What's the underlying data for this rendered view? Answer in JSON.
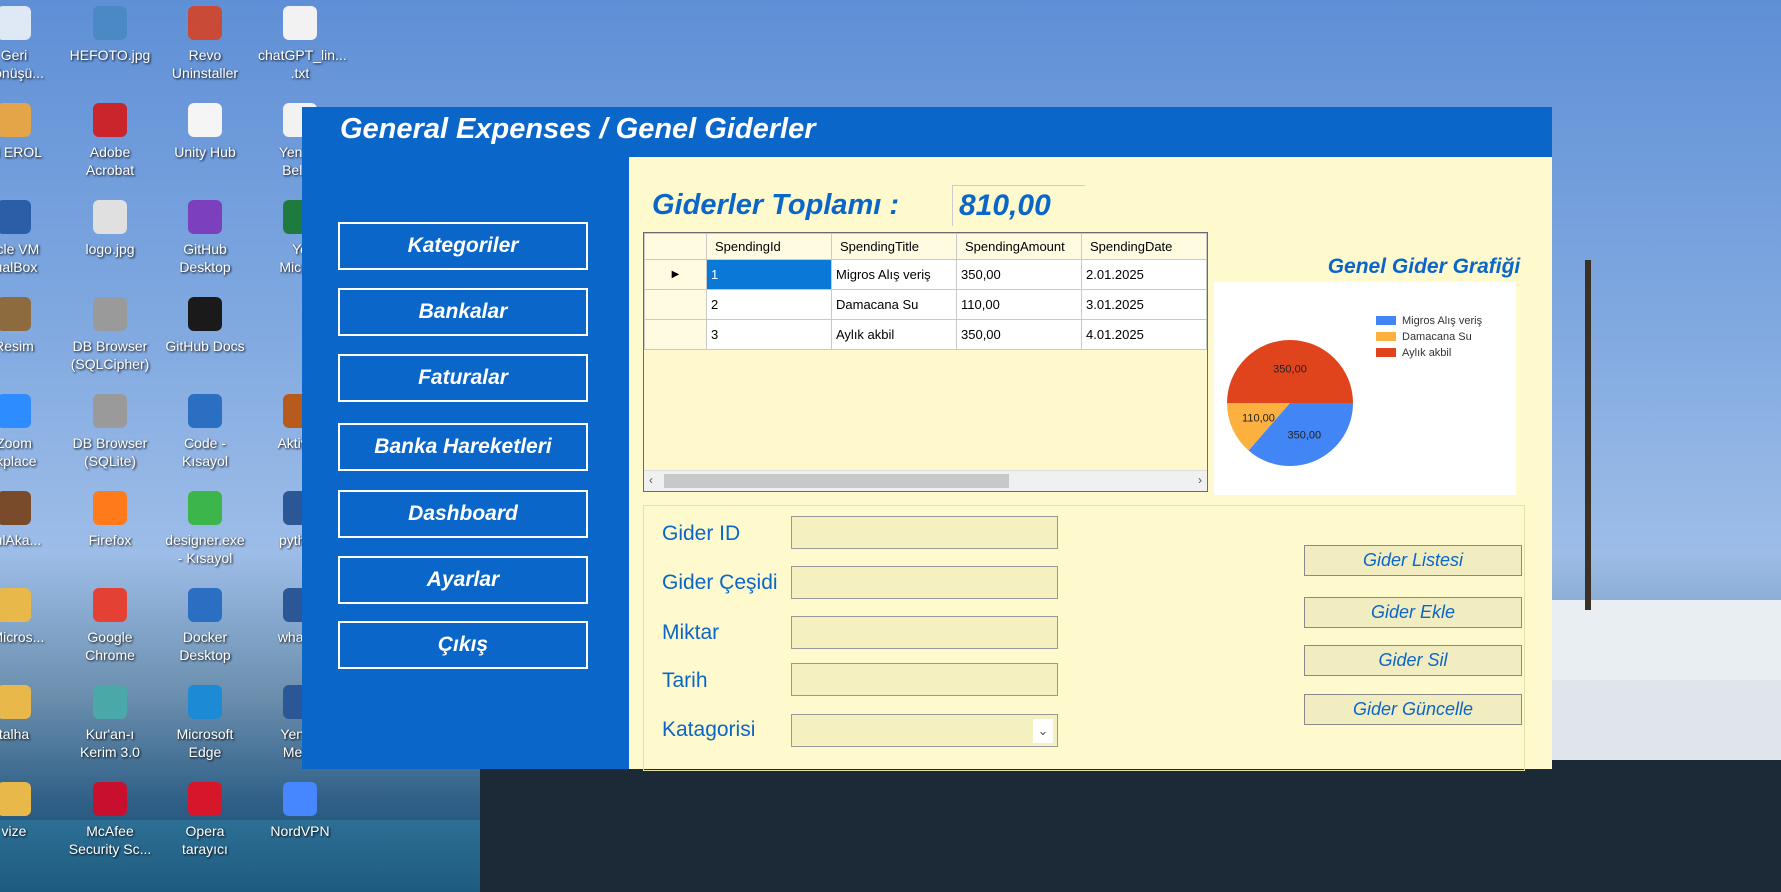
{
  "desktop": {
    "icons": [
      {
        "label": "Geri\nDönüşü...",
        "color": "#dfe9f6"
      },
      {
        "label": "HEFOTO.jpg",
        "color": "#4a89c4"
      },
      {
        "label": "Revo\nUninstaller",
        "color": "#c94b37"
      },
      {
        "label": "chatGPT_lin...\n.txt",
        "color": "#f2f2f2"
      },
      {
        "label": "IN EROL",
        "color": "#e4a548"
      },
      {
        "label": "Adobe\nAcrobat",
        "color": "#c9252b"
      },
      {
        "label": "Unity Hub",
        "color": "#f5f5f5"
      },
      {
        "label": "Yeni M\nBelge",
        "color": "#f2f2f2"
      },
      {
        "label": "acle VM\ntualBox",
        "color": "#2a5fa8"
      },
      {
        "label": "logo.jpg",
        "color": "#e0e0e0"
      },
      {
        "label": "GitHub\nDesktop",
        "color": "#7c3fbe"
      },
      {
        "label": "Ye\nMicros",
        "color": "#1f7a3e"
      },
      {
        "label": "Resim",
        "color": "#8e6b3f"
      },
      {
        "label": "DB Browser\n(SQLCipher)",
        "color": "#9a9a9a"
      },
      {
        "label": "GitHub Docs",
        "color": "#1a1a1a"
      },
      {
        "label": "Zoom\nrkplace",
        "color": "#2d8cff"
      },
      {
        "label": "DB Browser\n(SQLite)",
        "color": "#9a9a9a"
      },
      {
        "label": "Code -\nKısayol",
        "color": "#2a6fc2"
      },
      {
        "label": "Aktivas",
        "color": "#b85a1c"
      },
      {
        "label": "bulAka...",
        "color": "#7a4b2a"
      },
      {
        "label": "Firefox",
        "color": "#ff7a1a"
      },
      {
        "label": "designer.exe\n- Kısayol",
        "color": "#3cb54a"
      },
      {
        "label": "python",
        "color": "#2b5797"
      },
      {
        "label": "nMicros...",
        "color": "#e8b94a"
      },
      {
        "label": "Google\nChrome",
        "color": "#e44134"
      },
      {
        "label": "Docker\nDesktop",
        "color": "#2a6fc2"
      },
      {
        "label": "whatsa",
        "color": "#2b5797"
      },
      {
        "label": "talha",
        "color": "#e8b94a"
      },
      {
        "label": "Kur'an-ı\nKerim 3.0",
        "color": "#4aa8a8"
      },
      {
        "label": "Microsoft\nEdge",
        "color": "#1d8ad6"
      },
      {
        "label": "Yeni Z\nMetin",
        "color": "#2b5797"
      },
      {
        "label": "vize",
        "color": "#e8b94a"
      },
      {
        "label": "McAfee\nSecurity Sc...",
        "color": "#c8102e"
      },
      {
        "label": "Opera\ntarayıcı",
        "color": "#d6172a"
      },
      {
        "label": "NordVPN",
        "color": "#4687ff"
      }
    ]
  },
  "window": {
    "title": "General Expenses / Genel Giderler"
  },
  "sidebar": {
    "items": [
      {
        "label": "Kategoriler"
      },
      {
        "label": "Bankalar"
      },
      {
        "label": "Faturalar"
      },
      {
        "label": "Banka Hareketleri"
      },
      {
        "label": "Dashboard"
      },
      {
        "label": "Ayarlar"
      },
      {
        "label": "Çıkış"
      }
    ]
  },
  "summary": {
    "label": "Giderler Toplamı :",
    "value": "810,00"
  },
  "grid": {
    "columns": [
      "SpendingId",
      "SpendingTitle",
      "SpendingAmount",
      "SpendingDate"
    ],
    "rows": [
      [
        "1",
        "Migros Alış veriş",
        "350,00",
        "2.01.2025"
      ],
      [
        "2",
        "Damacana Su",
        "110,00",
        "3.01.2025"
      ],
      [
        "3",
        "Aylık akbil",
        "350,00",
        "4.01.2025"
      ]
    ],
    "selected_row": 0,
    "row_indicator": "▶",
    "scroll_left": "‹",
    "scroll_right": "›"
  },
  "chart_title": "Genel Gider Grafiği",
  "chart_data": {
    "type": "pie",
    "categories": [
      "Migros Alış veriş",
      "Damacana Su",
      "Aylık akbil"
    ],
    "values": [
      350,
      110,
      350
    ],
    "value_labels": [
      "350,00",
      "110,00",
      "350,00"
    ],
    "colors": [
      "#4285f4",
      "#fbb040",
      "#e0441c"
    ],
    "legend_position": "top-right"
  },
  "form": {
    "fields": [
      {
        "label": "Gider ID",
        "value": ""
      },
      {
        "label": "Gider Çeşidi",
        "value": ""
      },
      {
        "label": "Miktar",
        "value": ""
      },
      {
        "label": "Tarih",
        "value": ""
      },
      {
        "label": "Katagorisi",
        "value": ""
      }
    ],
    "dropdown_arrow": "⌄"
  },
  "actions": [
    {
      "label": "Gider Listesi"
    },
    {
      "label": "Gider Ekle"
    },
    {
      "label": "Gider Sil"
    },
    {
      "label": "Gider Güncelle"
    }
  ]
}
